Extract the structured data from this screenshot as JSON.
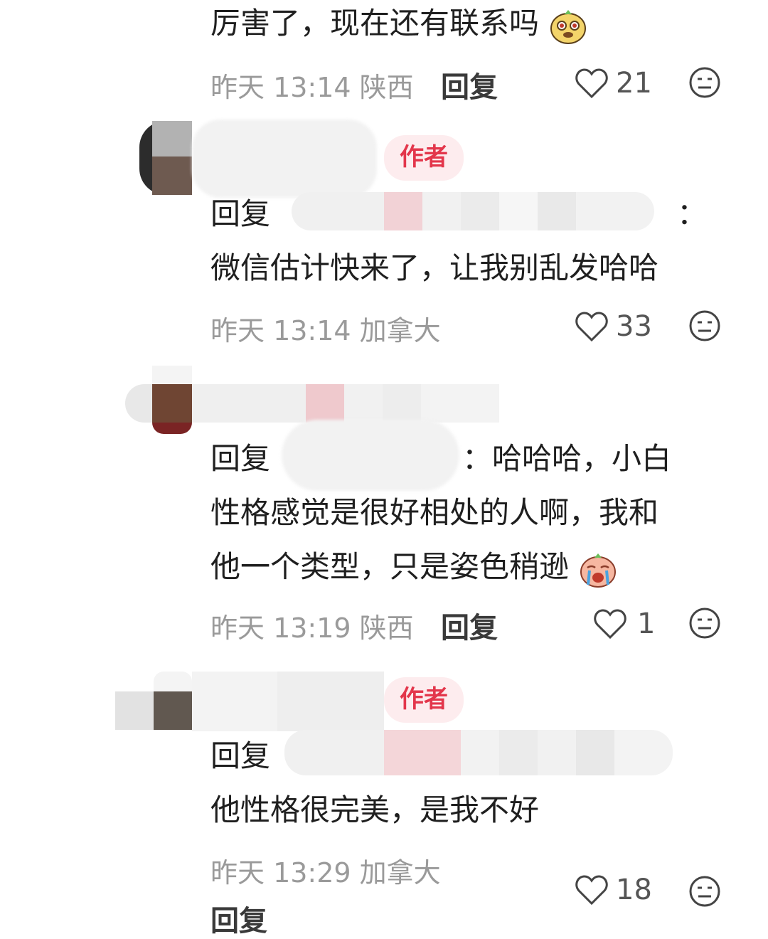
{
  "comments": [
    {
      "text_lines": [
        "厉害了，现在还有联系吗"
      ],
      "meta": "昨天 13:14 陕西",
      "reply_label": "回复",
      "likes": "21"
    },
    {
      "author_tag": "作者",
      "reply_prefix": "回复",
      "reply_suffix": "：",
      "text_lines": [
        "微信估计快来了，让我别乱发哈哈"
      ],
      "meta": "昨天 13:14 加拿大",
      "likes": "33"
    },
    {
      "reply_prefix": "回复",
      "reply_suffix": "：哈哈哈，小白",
      "text_lines": [
        "性格感觉是很好相处的人啊，我和",
        "他一个类型，只是姿色稍逊"
      ],
      "meta": "昨天 13:19 陕西",
      "reply_label": "回复",
      "likes": "1"
    },
    {
      "author_tag": "作者",
      "reply_prefix": "回复",
      "text_lines": [
        "他性格很完美，是我不好"
      ],
      "meta": "昨天 13:29 加拿大",
      "reply_label": "回复",
      "likes": "18"
    }
  ],
  "icons": {
    "heart": "heart-outline-icon",
    "dislike": "neutral-face-icon",
    "emoji_dog": "dog-face-emoji",
    "emoji_cry": "crying-face-emoji"
  },
  "colors": {
    "author_tag_text": "#e3364b",
    "author_tag_bg": "#fdecee",
    "meta_gray": "#9a9a9a"
  }
}
